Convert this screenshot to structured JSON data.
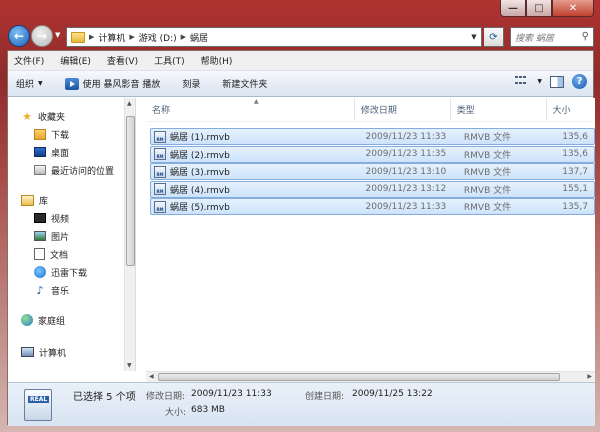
{
  "window": {
    "controls": {
      "minimize": "—",
      "maximize": "□",
      "close": "✕"
    }
  },
  "address": {
    "crumbs": [
      "计算机",
      "游戏 (D:)",
      "蜗居"
    ],
    "search_placeholder": "搜索 蜗居"
  },
  "menu": [
    "文件(F)",
    "编辑(E)",
    "查看(V)",
    "工具(T)",
    "帮助(H)"
  ],
  "toolbar": {
    "organize": "组织",
    "play": "使用 暴风影音 播放",
    "burn": "刻录",
    "new_folder": "新建文件夹"
  },
  "nav": {
    "favorites": "收藏夹",
    "downloads": "下载",
    "desktop": "桌面",
    "recent": "最近访问的位置",
    "libraries": "库",
    "videos": "视频",
    "pictures": "图片",
    "documents": "文档",
    "thunder": "迅雷下载",
    "music": "音乐",
    "homegroup": "家庭组",
    "computer": "计算机"
  },
  "columns": {
    "name": "名称",
    "date": "修改日期",
    "type": "类型",
    "size": "大小"
  },
  "files": [
    {
      "name": "蜗居 (1).rmvb",
      "date": "2009/11/23 11:33",
      "type": "RMVB 文件",
      "size": "135,6"
    },
    {
      "name": "蜗居 (2).rmvb",
      "date": "2009/11/23 11:35",
      "type": "RMVB 文件",
      "size": "135,6"
    },
    {
      "name": "蜗居 (3).rmvb",
      "date": "2009/11/23 13:10",
      "type": "RMVB 文件",
      "size": "137,7"
    },
    {
      "name": "蜗居 (4).rmvb",
      "date": "2009/11/23 13:12",
      "type": "RMVB 文件",
      "size": "155,1"
    },
    {
      "name": "蜗居 (5).rmvb",
      "date": "2009/11/23 11:33",
      "type": "RMVB 文件",
      "size": "135,7"
    }
  ],
  "details": {
    "selected": "已选择 5 个项",
    "modified_label": "修改日期:",
    "modified_value": "2009/11/23 11:33",
    "created_label": "创建日期:",
    "created_value": "2009/11/25 13:22",
    "size_label": "大小:",
    "size_value": "683 MB",
    "icon_text": "REAL"
  }
}
